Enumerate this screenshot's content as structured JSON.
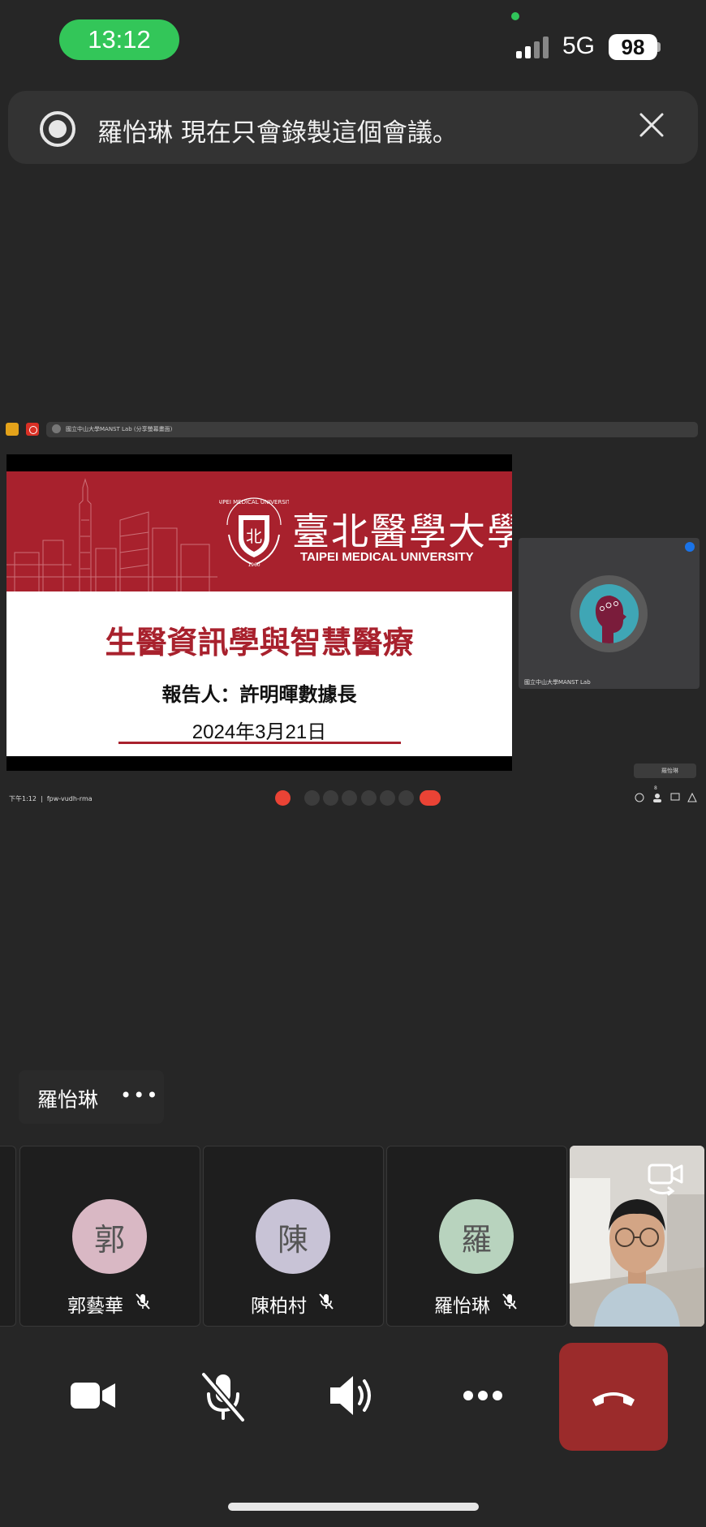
{
  "status_bar": {
    "time": "13:12",
    "network": "5G",
    "battery": "98"
  },
  "recording_banner": {
    "text": "羅怡琳 現在只會錄製這個會議。"
  },
  "shared_screen": {
    "tab_title": "國立中山大學MANST Lab (分享螢幕畫面)",
    "slide": {
      "university_zh": "臺北醫學大學",
      "university_en": "TAIPEI MEDICAL UNIVERSITY",
      "crest_en": "TAIPEI MEDICAL UNIVERSITY",
      "crest_year": "1960",
      "title": "生醫資訊學與智慧醫療",
      "presenter": "報告人：許明暉數據長",
      "date": "2024年3月21日"
    },
    "tile_name": "國立中山大學MANST Lab",
    "mini_label": "羅怡琳",
    "meeting_time": "下午1:12",
    "meeting_code": "fpw-vudh-rma",
    "participant_count": "8"
  },
  "active_speaker_chip": {
    "name": "羅怡琳",
    "more": "•••"
  },
  "participants": [
    {
      "initial": "郭",
      "name": "郭藝華",
      "avatar_color": "#d9b8c4",
      "muted": true
    },
    {
      "initial": "陳",
      "name": "陳柏村",
      "avatar_color": "#c8c3d6",
      "muted": true
    },
    {
      "initial": "羅",
      "name": "羅怡琳",
      "avatar_color": "#b8d3be",
      "muted": true
    }
  ],
  "controls": {
    "camera": "video-camera-icon",
    "mic": "mic-muted-icon",
    "speaker": "speaker-icon",
    "more": "more-icon",
    "end": "end-call-icon"
  },
  "colors": {
    "accent_green": "#33c659",
    "end_call": "#9b2b2b",
    "tmu_red": "#a8212d",
    "meet_red": "#ea4335"
  }
}
